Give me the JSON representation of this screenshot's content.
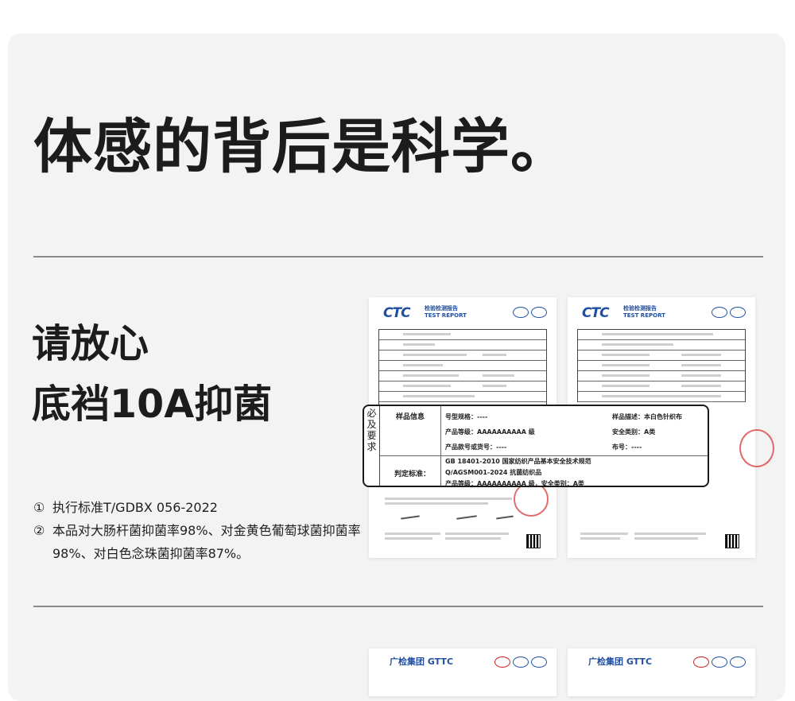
{
  "headline": "体感的背后是科学。",
  "subtitle": {
    "line1": "请放心",
    "line2": "底裆10A抑菌"
  },
  "notes": [
    {
      "num": "①",
      "text": "执行标准T/GDBX 056-2022"
    },
    {
      "num": "②",
      "text": "本品对大肠杆菌抑菌率98%、对金黄色葡萄球菌抑菌率98%、对白色念珠菌抑菌率87%。"
    }
  ],
  "report": {
    "logo": "CTC",
    "title_cn": "检验检测报告",
    "title_en": "TEST REPORT",
    "side_label": "必及要求",
    "sample_info_label": "样品信息",
    "model_label": "号型规格：----",
    "grade_label": "产品等级：AAAAAAAAAA 级",
    "item_no_label": "产品款号或货号：----",
    "desc_label": "样品描述：本白色针织布",
    "safety_label": "安全类别：A类",
    "fabric_no_label": "布号：----",
    "judge_label": "判定标准：",
    "standard1": "GB 18401-2010 国家纺织产品基本安全技术规范",
    "standard2": "Q/AGSM001-2024 抗菌纺织品",
    "standard3": "产品等级：AAAAAAAAAA 级，安全类别：A类"
  },
  "report2": {
    "logo": "广检集团",
    "logo_en": "GTTC"
  }
}
